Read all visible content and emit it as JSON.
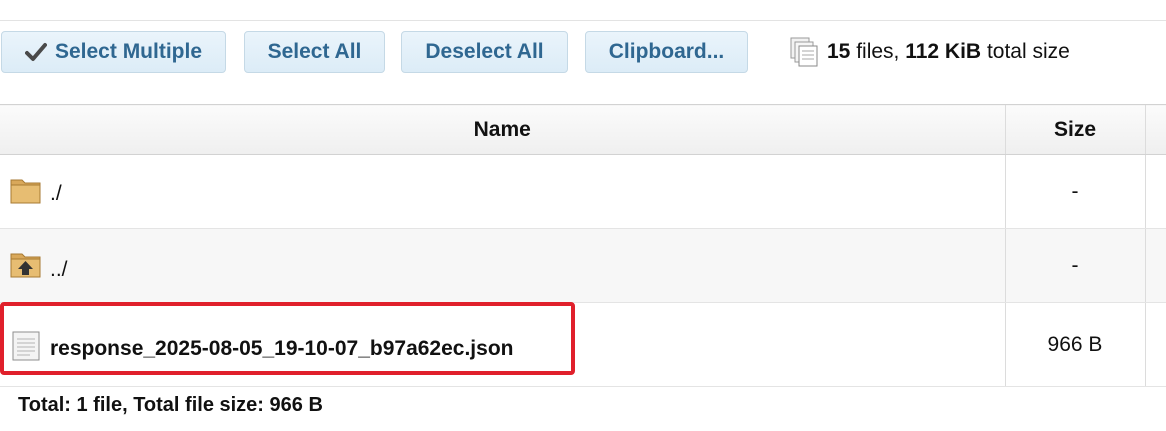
{
  "toolbar": {
    "select_multiple": "Select Multiple",
    "select_all": "Select All",
    "deselect_all": "Deselect All",
    "clipboard": "Clipboard..."
  },
  "summary": {
    "file_count": "15",
    "files_word": " files, ",
    "total_size": "112 KiB",
    "suffix": " total size"
  },
  "table": {
    "headers": {
      "name": "Name",
      "size": "Size"
    },
    "rows": [
      {
        "name": "./",
        "size": "-",
        "icon": "folder-icon"
      },
      {
        "name": "../",
        "size": "-",
        "icon": "parent-folder-icon"
      },
      {
        "name": "response_2025-08-05_19-10-07_b97a62ec.json",
        "size": "966 B",
        "icon": "file-icon"
      }
    ]
  },
  "footer": {
    "text": "Total: 1 file, Total file size: 966 B"
  },
  "colors": {
    "button_text": "#2f6791",
    "highlight": "#e0202b"
  }
}
